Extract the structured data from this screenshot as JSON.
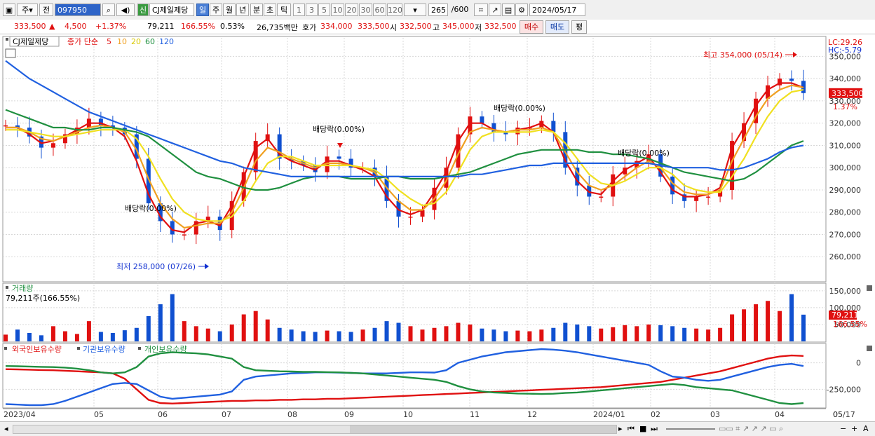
{
  "toolbar": {
    "market": "주",
    "prev": "전",
    "code": "097950",
    "new_badge": "신",
    "stock_name": "CJ제일제당",
    "periods": [
      "일",
      "주",
      "월",
      "년",
      "분",
      "초",
      "틱"
    ],
    "selected_period": "일",
    "intervals": [
      "1",
      "3",
      "5",
      "10",
      "20",
      "30",
      "60",
      "120"
    ],
    "count": "265",
    "count_total": "/600",
    "date": "2024/05/17"
  },
  "info": {
    "price": "333,500",
    "arrow": "▲",
    "change": "4,500",
    "change_pct": "+1.37%",
    "volume": "79,211",
    "volume_ratio": "166.55%",
    "turnover_pct": "0.53%",
    "amount": "26,735백만",
    "ask_label": "호가",
    "ask": "334,000",
    "bid": "333,500",
    "open_label": "시",
    "open": "332,500",
    "high_label": "고",
    "high": "345,000",
    "low_label": "저",
    "low": "332,500",
    "buy": "매수",
    "sell": "매도",
    "avg": "평"
  },
  "legend": {
    "name": "CJ제일제당",
    "series": "종가 단순",
    "ma": [
      "5",
      "10",
      "20",
      "60",
      "120"
    ],
    "ma_colors": [
      "#e01010",
      "#f0a020",
      "#f0e020",
      "#209040",
      "#2060e0"
    ]
  },
  "annotations": {
    "high": "최고 354,000 (05/14)",
    "low": "최저 258,000 (07/26)",
    "dividend": "배당락(0.00%)",
    "lc": "LC:29.26",
    "hc": "HC:-5.79",
    "last_price": "333,500",
    "last_pct": "1.37%"
  },
  "volume_panel": {
    "title": "거래량",
    "value": "79,211주(166.55%)",
    "last": "79,211",
    "last_pct": "166.55%"
  },
  "holdings_panel": {
    "labels": [
      "외국인보유수량",
      "기관보유수량",
      "개인보유수량"
    ],
    "colors": [
      "#e01010",
      "#2060e0",
      "#209040"
    ]
  },
  "chart_data": [
    {
      "type": "line",
      "title": "CJ제일제당",
      "ylim": [
        250000,
        358000
      ],
      "y_ticks": [
        260000,
        270000,
        280000,
        290000,
        300000,
        310000,
        320000,
        330000,
        340000,
        350000
      ],
      "x_tick_labels": [
        "2023/04",
        "05",
        "06",
        "07",
        "08",
        "09",
        "10",
        "11",
        "12",
        "2024/01",
        "02",
        "03",
        "04",
        "05",
        "05/17"
      ],
      "series": [
        {
          "name": "종가",
          "values": [
            319000,
            318000,
            314000,
            309000,
            311000,
            315000,
            318000,
            322000,
            319000,
            318000,
            315000,
            304000,
            284000,
            276000,
            270000,
            270000,
            276000,
            278000,
            272000,
            285000,
            298000,
            312000,
            315000,
            304000,
            303000,
            301000,
            298000,
            305000,
            304000,
            300000,
            300000,
            296000,
            285000,
            278000,
            278000,
            281000,
            291000,
            300000,
            315000,
            323000,
            320000,
            316000,
            315000,
            318000,
            318000,
            321000,
            316000,
            300000,
            292000,
            287000,
            287000,
            297000,
            300000,
            303000,
            306000,
            296000,
            288000,
            285000,
            287000,
            287000,
            290000,
            312000,
            320000,
            331000,
            337000,
            340000,
            339000,
            333500
          ]
        },
        {
          "name": "5",
          "values": [
            318000,
            318000,
            315000,
            311000,
            312000,
            314000,
            317000,
            320000,
            320000,
            318000,
            314000,
            303000,
            288000,
            278000,
            272000,
            271000,
            275000,
            276000,
            274000,
            283000,
            296000,
            309000,
            313000,
            306000,
            303000,
            301000,
            299000,
            303000,
            303000,
            301000,
            299000,
            296000,
            287000,
            281000,
            279000,
            281000,
            289000,
            298000,
            312000,
            320000,
            320000,
            317000,
            316000,
            317000,
            318000,
            320000,
            316000,
            303000,
            294000,
            289000,
            288000,
            294000,
            299000,
            302000,
            305000,
            298000,
            290000,
            287000,
            287000,
            288000,
            291000,
            309000,
            318000,
            328000,
            335000,
            338000,
            338000,
            336000
          ]
        },
        {
          "name": "10",
          "values": [
            318000,
            318000,
            316000,
            313000,
            312000,
            314000,
            316000,
            318000,
            319000,
            318000,
            316000,
            308000,
            295000,
            284000,
            277000,
            273000,
            274000,
            275000,
            275000,
            280000,
            291000,
            303000,
            309000,
            307000,
            304000,
            302000,
            300000,
            302000,
            302000,
            301000,
            300000,
            298000,
            291000,
            285000,
            281000,
            281000,
            286000,
            294000,
            306000,
            316000,
            318000,
            317000,
            316000,
            317000,
            317000,
            318000,
            316000,
            307000,
            298000,
            292000,
            290000,
            292000,
            296000,
            300000,
            303000,
            300000,
            293000,
            289000,
            288000,
            288000,
            290000,
            303000,
            313000,
            323000,
            331000,
            335000,
            337000,
            336000
          ]
        },
        {
          "name": "20",
          "values": [
            317000,
            317000,
            316000,
            315000,
            314000,
            314000,
            315000,
            316000,
            317000,
            317000,
            317000,
            313000,
            305000,
            295000,
            286000,
            280000,
            277000,
            276000,
            276000,
            278000,
            285000,
            294000,
            302000,
            305000,
            305000,
            303000,
            301000,
            301000,
            301000,
            301000,
            300000,
            299000,
            295000,
            290000,
            286000,
            283000,
            284000,
            289000,
            298000,
            308000,
            314000,
            316000,
            316000,
            316000,
            316000,
            317000,
            316000,
            311000,
            304000,
            297000,
            293000,
            292000,
            294000,
            297000,
            300000,
            300000,
            297000,
            292000,
            290000,
            289000,
            289000,
            296000,
            304000,
            314000,
            323000,
            330000,
            334000,
            335000
          ]
        },
        {
          "name": "60",
          "values": [
            326000,
            324000,
            322000,
            320000,
            318000,
            318000,
            317000,
            317000,
            318000,
            318000,
            317000,
            316000,
            314000,
            310000,
            306000,
            302000,
            298000,
            296000,
            295000,
            293000,
            291000,
            290000,
            290000,
            291000,
            293000,
            295000,
            296000,
            296000,
            296000,
            295000,
            295000,
            295000,
            296000,
            296000,
            295000,
            295000,
            295000,
            296000,
            297000,
            298000,
            300000,
            302000,
            304000,
            306000,
            307000,
            308000,
            308000,
            308000,
            308000,
            307000,
            307000,
            306000,
            306000,
            305000,
            304000,
            302000,
            300000,
            298000,
            297000,
            296000,
            295000,
            294000,
            295000,
            298000,
            302000,
            306000,
            310000,
            312000
          ]
        },
        {
          "name": "120",
          "values": [
            348000,
            344000,
            340000,
            337000,
            334000,
            331000,
            328000,
            325000,
            323000,
            321000,
            319000,
            317000,
            315000,
            313000,
            311000,
            309000,
            307000,
            305000,
            303000,
            302000,
            300000,
            299000,
            298000,
            297000,
            296000,
            296000,
            296000,
            296000,
            296000,
            296000,
            296000,
            296000,
            296000,
            296000,
            296000,
            296000,
            296000,
            296000,
            296000,
            297000,
            297000,
            298000,
            299000,
            300000,
            301000,
            301000,
            302000,
            302000,
            302000,
            302000,
            302000,
            302000,
            302000,
            302000,
            302000,
            301000,
            300000,
            300000,
            300000,
            300000,
            299000,
            299000,
            300000,
            302000,
            304000,
            307000,
            309000,
            310000
          ]
        }
      ],
      "annotations": [
        "최고 354,000 (05/14)",
        "최저 258,000 (07/26)",
        "배당락(0.00%)"
      ]
    },
    {
      "type": "bar",
      "title": "거래량",
      "ylim": [
        0,
        160000
      ],
      "y_ticks": [
        50000,
        100000,
        150000
      ],
      "series": [
        {
          "name": "거래량",
          "values": [
            20000,
            35000,
            25000,
            18000,
            45000,
            30000,
            22000,
            60000,
            28000,
            25000,
            33000,
            40000,
            75000,
            110000,
            140000,
            60000,
            45000,
            38000,
            30000,
            50000,
            80000,
            90000,
            65000,
            40000,
            35000,
            30000,
            28000,
            32000,
            30000,
            28000,
            35000,
            40000,
            60000,
            55000,
            45000,
            35000,
            40000,
            45000,
            55000,
            50000,
            38000,
            35000,
            30000,
            32000,
            30000,
            35000,
            40000,
            55000,
            50000,
            45000,
            38000,
            42000,
            48000,
            45000,
            50000,
            48000,
            45000,
            40000,
            38000,
            35000,
            40000,
            80000,
            95000,
            110000,
            120000,
            90000,
            140000,
            79211
          ]
        }
      ]
    },
    {
      "type": "line",
      "title": "보유수량",
      "ylim": [
        -420000,
        150000
      ],
      "y_ticks": [
        0,
        -250000
      ],
      "series": [
        {
          "name": "외국인보유수량",
          "values": [
            -60000,
            -62000,
            -65000,
            -68000,
            -70000,
            -75000,
            -80000,
            -85000,
            -90000,
            -100000,
            -150000,
            -250000,
            -350000,
            -380000,
            -385000,
            -380000,
            -375000,
            -370000,
            -365000,
            -360000,
            -360000,
            -355000,
            -355000,
            -350000,
            -350000,
            -345000,
            -345000,
            -340000,
            -340000,
            -335000,
            -330000,
            -325000,
            -320000,
            -315000,
            -310000,
            -305000,
            -300000,
            -295000,
            -290000,
            -285000,
            -280000,
            -275000,
            -270000,
            -265000,
            -260000,
            -255000,
            -250000,
            -245000,
            -240000,
            -235000,
            -230000,
            -220000,
            -210000,
            -200000,
            -190000,
            -180000,
            -160000,
            -140000,
            -120000,
            -100000,
            -80000,
            -50000,
            -20000,
            10000,
            40000,
            60000,
            70000,
            65000
          ]
        },
        {
          "name": "기관보유수량",
          "values": [
            -390000,
            -395000,
            -400000,
            -400000,
            -390000,
            -360000,
            -320000,
            -280000,
            -240000,
            -200000,
            -190000,
            -200000,
            -260000,
            -320000,
            -340000,
            -330000,
            -320000,
            -310000,
            -300000,
            -270000,
            -160000,
            -130000,
            -120000,
            -110000,
            -100000,
            -95000,
            -90000,
            -90000,
            -92000,
            -95000,
            -100000,
            -100000,
            -100000,
            -95000,
            -90000,
            -90000,
            -92000,
            -70000,
            0,
            30000,
            60000,
            80000,
            100000,
            110000,
            120000,
            130000,
            125000,
            115000,
            100000,
            80000,
            60000,
            40000,
            20000,
            0,
            -20000,
            -80000,
            -130000,
            -140000,
            -160000,
            -170000,
            -160000,
            -130000,
            -100000,
            -70000,
            -40000,
            -20000,
            -10000,
            -30000
          ]
        },
        {
          "name": "개인보유수량",
          "values": [
            -30000,
            -32000,
            -35000,
            -38000,
            -40000,
            -45000,
            -55000,
            -70000,
            -90000,
            -100000,
            -90000,
            -40000,
            60000,
            90000,
            100000,
            95000,
            90000,
            80000,
            60000,
            40000,
            -40000,
            -70000,
            -75000,
            -80000,
            -82000,
            -85000,
            -85000,
            -88000,
            -90000,
            -95000,
            -100000,
            -110000,
            -120000,
            -130000,
            -140000,
            -150000,
            -160000,
            -180000,
            -220000,
            -250000,
            -270000,
            -280000,
            -285000,
            -290000,
            -292000,
            -295000,
            -292000,
            -285000,
            -280000,
            -270000,
            -260000,
            -250000,
            -240000,
            -230000,
            -220000,
            -210000,
            -200000,
            -210000,
            -230000,
            -240000,
            -250000,
            -260000,
            -290000,
            -320000,
            -350000,
            -380000,
            -390000,
            -380000
          ]
        }
      ]
    }
  ]
}
